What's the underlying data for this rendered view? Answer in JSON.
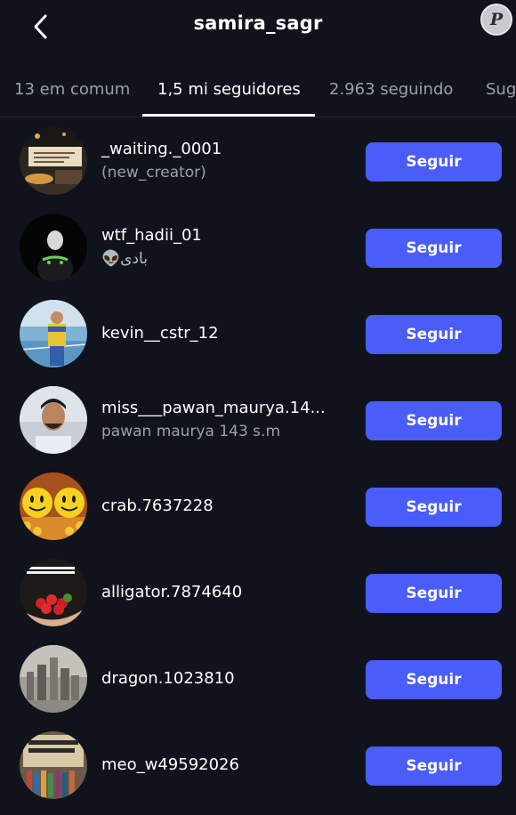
{
  "header": {
    "title": "samira_sagr",
    "back_icon": "chevron-left-icon",
    "watermark": "P"
  },
  "tabs": [
    {
      "label": "13 em comum",
      "active": false
    },
    {
      "label": "1,5 mi seguidores",
      "active": true
    },
    {
      "label": "2.963 seguindo",
      "active": false
    },
    {
      "label": "Sug",
      "active": false
    }
  ],
  "follow_label": "Seguir",
  "button_color": "#4a5df9",
  "users": [
    {
      "username": "_waiting._0001",
      "name": "(new_creator)",
      "avatar": "cafe-sign-photo"
    },
    {
      "username": "wtf_hadii_01",
      "name": "👽بادی",
      "avatar": "dark-figure-photo"
    },
    {
      "username": "kevin__cstr_12",
      "name": "",
      "avatar": "boy-court-photo"
    },
    {
      "username": "miss___pawan_maurya.14...",
      "name": "pawan maurya 143 s.m",
      "avatar": "man-selfie-photo"
    },
    {
      "username": "crab.7637228",
      "name": "",
      "avatar": "smiley-balls-photo"
    },
    {
      "username": "alligator.7874640",
      "name": "",
      "avatar": "eat-kind-strawberries"
    },
    {
      "username": "dragon.1023810",
      "name": "",
      "avatar": "hazy-city-photo"
    },
    {
      "username": "meo_w49592026",
      "name": "",
      "avatar": "support-libraries-sign"
    }
  ]
}
